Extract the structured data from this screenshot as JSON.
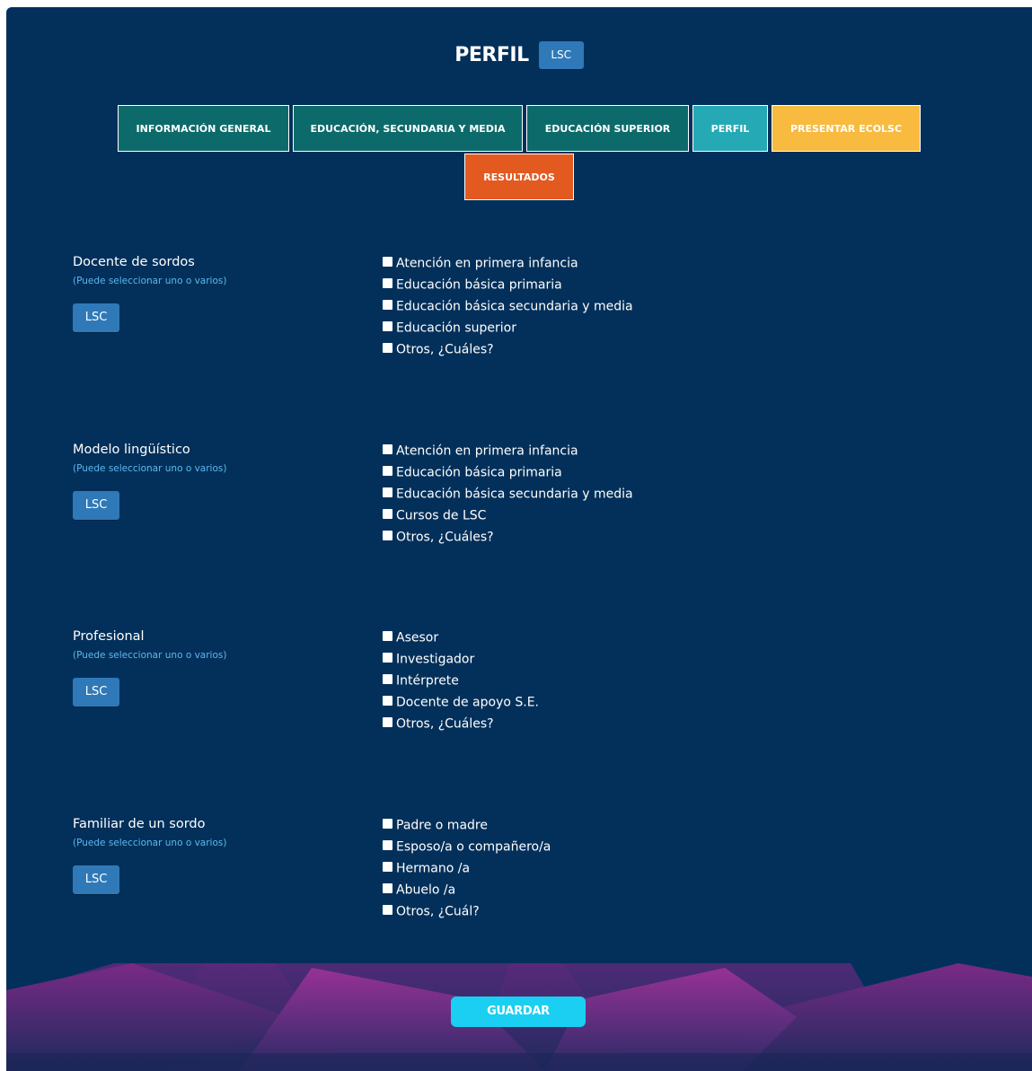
{
  "header": {
    "title": "PERFIL",
    "lsc_label": "LSC"
  },
  "tabs": [
    {
      "label": "INFORMACIÓN GENERAL",
      "color": "#0c6b6a"
    },
    {
      "label": "EDUCACIÓN, SECUNDARIA Y MEDIA",
      "color": "#0c6b6a"
    },
    {
      "label": "EDUCACIÓN SUPERIOR",
      "color": "#0c6b6a"
    },
    {
      "label": "PERFIL",
      "color": "#25a9b4"
    },
    {
      "label": "PRESENTAR ECOLSC",
      "color": "#f8ba3f"
    },
    {
      "label": "RESULTADOS",
      "color": "#e35a20"
    }
  ],
  "sections": [
    {
      "title": "Docente de sordos",
      "hint": "(Puede seleccionar uno o varios)",
      "lsc_label": "LSC",
      "options": [
        {
          "label": "Atención en primera infancia",
          "checked": false
        },
        {
          "label": "Educación básica primaria",
          "checked": false
        },
        {
          "label": "Educación básica secundaria y media",
          "checked": false
        },
        {
          "label": "Educación superior",
          "checked": false
        },
        {
          "label": "Otros, ¿Cuáles?",
          "checked": false
        }
      ]
    },
    {
      "title": "Modelo lingüístico",
      "hint": "(Puede seleccionar uno o varios)",
      "lsc_label": "LSC",
      "options": [
        {
          "label": "Atención en primera infancia",
          "checked": false
        },
        {
          "label": "Educación básica primaria",
          "checked": false
        },
        {
          "label": "Educación básica secundaria y media",
          "checked": false
        },
        {
          "label": "Cursos de LSC",
          "checked": false
        },
        {
          "label": "Otros, ¿Cuáles?",
          "checked": false
        }
      ]
    },
    {
      "title": "Profesional",
      "hint": "(Puede seleccionar uno o varios)",
      "lsc_label": "LSC",
      "options": [
        {
          "label": "Asesor",
          "checked": false
        },
        {
          "label": "Investigador",
          "checked": false
        },
        {
          "label": "Intérprete",
          "checked": false
        },
        {
          "label": "Docente de apoyo S.E.",
          "checked": false
        },
        {
          "label": "Otros, ¿Cuáles?",
          "checked": false
        }
      ]
    },
    {
      "title": "Familiar de un sordo",
      "hint": "(Puede seleccionar uno o varios)",
      "lsc_label": "LSC",
      "options": [
        {
          "label": "Padre o madre",
          "checked": false
        },
        {
          "label": "Esposo/a o compañero/a",
          "checked": false
        },
        {
          "label": "Hermano /a",
          "checked": false
        },
        {
          "label": "Abuelo /a",
          "checked": false
        },
        {
          "label": "Otros, ¿Cuál?",
          "checked": false
        }
      ]
    }
  ],
  "footer": {
    "save_label": "GUARDAR"
  },
  "colors": {
    "background": "#03305a",
    "lsc_button": "#2f79b8",
    "hint_text": "#5cb8ef",
    "save_button": "#1bcff3"
  }
}
